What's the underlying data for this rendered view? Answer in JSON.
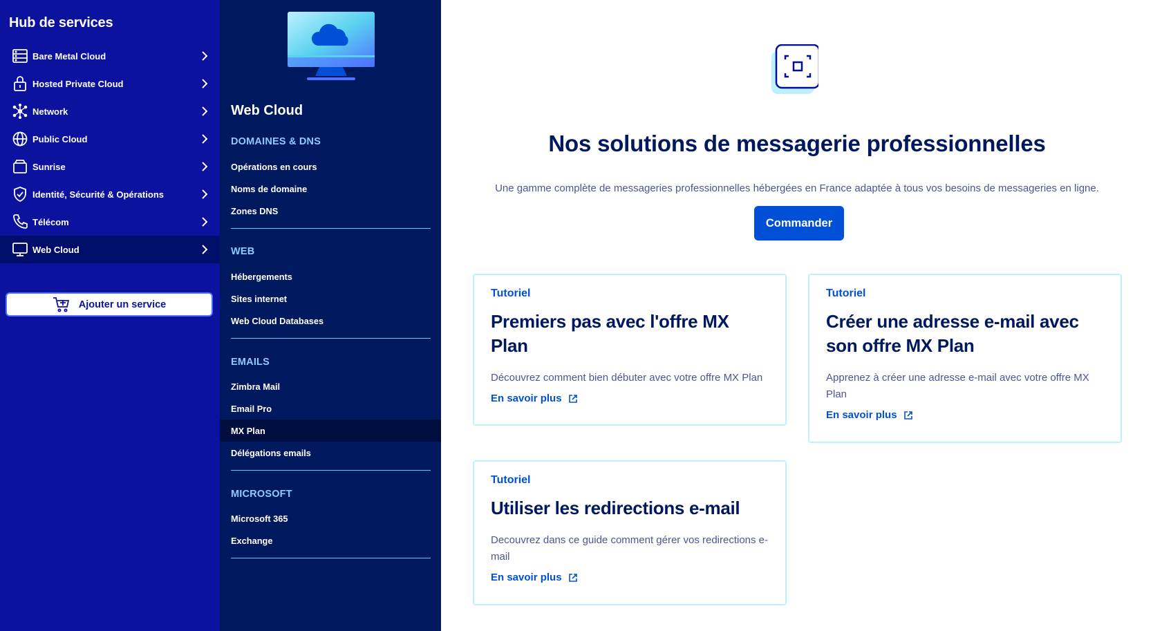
{
  "sidebar": {
    "title": "Hub de services",
    "items": [
      {
        "label": "Bare Metal Cloud",
        "icon": "server-icon"
      },
      {
        "label": "Hosted Private Cloud",
        "icon": "lock-icon"
      },
      {
        "label": "Network",
        "icon": "network-icon"
      },
      {
        "label": "Public Cloud",
        "icon": "globe-icon"
      },
      {
        "label": "Sunrise",
        "icon": "box-icon"
      },
      {
        "label": "Identité, Sécurité & Opérations",
        "icon": "shield-icon"
      },
      {
        "label": "Télécom",
        "icon": "phone-icon"
      },
      {
        "label": "Web Cloud",
        "icon": "monitor-icon"
      }
    ],
    "active_item": "Web Cloud",
    "add_service_label": "Ajouter un service"
  },
  "subnav": {
    "title": "Web Cloud",
    "sections": [
      {
        "title": "DOMAINES & DNS",
        "links": [
          "Opérations en cours",
          "Noms de domaine",
          "Zones DNS"
        ]
      },
      {
        "title": "WEB",
        "links": [
          "Hébergements",
          "Sites internet",
          "Web Cloud Databases"
        ]
      },
      {
        "title": "EMAILS",
        "links": [
          "Zimbra Mail",
          "Email Pro",
          "MX Plan",
          "Délégations emails"
        ]
      },
      {
        "title": "MICROSOFT",
        "links": [
          "Microsoft 365",
          "Exchange"
        ]
      }
    ],
    "active_link": "MX Plan"
  },
  "main": {
    "heading": "Nos solutions de messagerie professionnelles",
    "description": "Une gamme complète de messageries professionnelles hébergées en France adaptée à tous vos besoins de messageries en ligne.",
    "cta_label": "Commander",
    "cards": [
      {
        "kicker": "Tutoriel",
        "title": "Premiers pas avec l'offre MX Plan",
        "description": "Découvrez comment bien débuter avec votre offre MX Plan",
        "link": "En savoir plus"
      },
      {
        "kicker": "Tutoriel",
        "title": "Créer une adresse e-mail avec son offre MX Plan",
        "description": "Apprenez à créer une adresse e-mail avec votre offre MX Plan",
        "link": "En savoir plus"
      },
      {
        "kicker": "Tutoriel",
        "title": "Utiliser les redirections e-mail",
        "description": "Decouvrez dans ce guide comment gérer vos redirections e-mail",
        "link": "En savoir plus"
      }
    ]
  },
  "colors": {
    "sidebar_bg": "#0a129e",
    "subnav_bg": "#00185e",
    "accent": "#0050d7",
    "section_title": "#8ccbff",
    "card_border": "#bef1ff"
  }
}
